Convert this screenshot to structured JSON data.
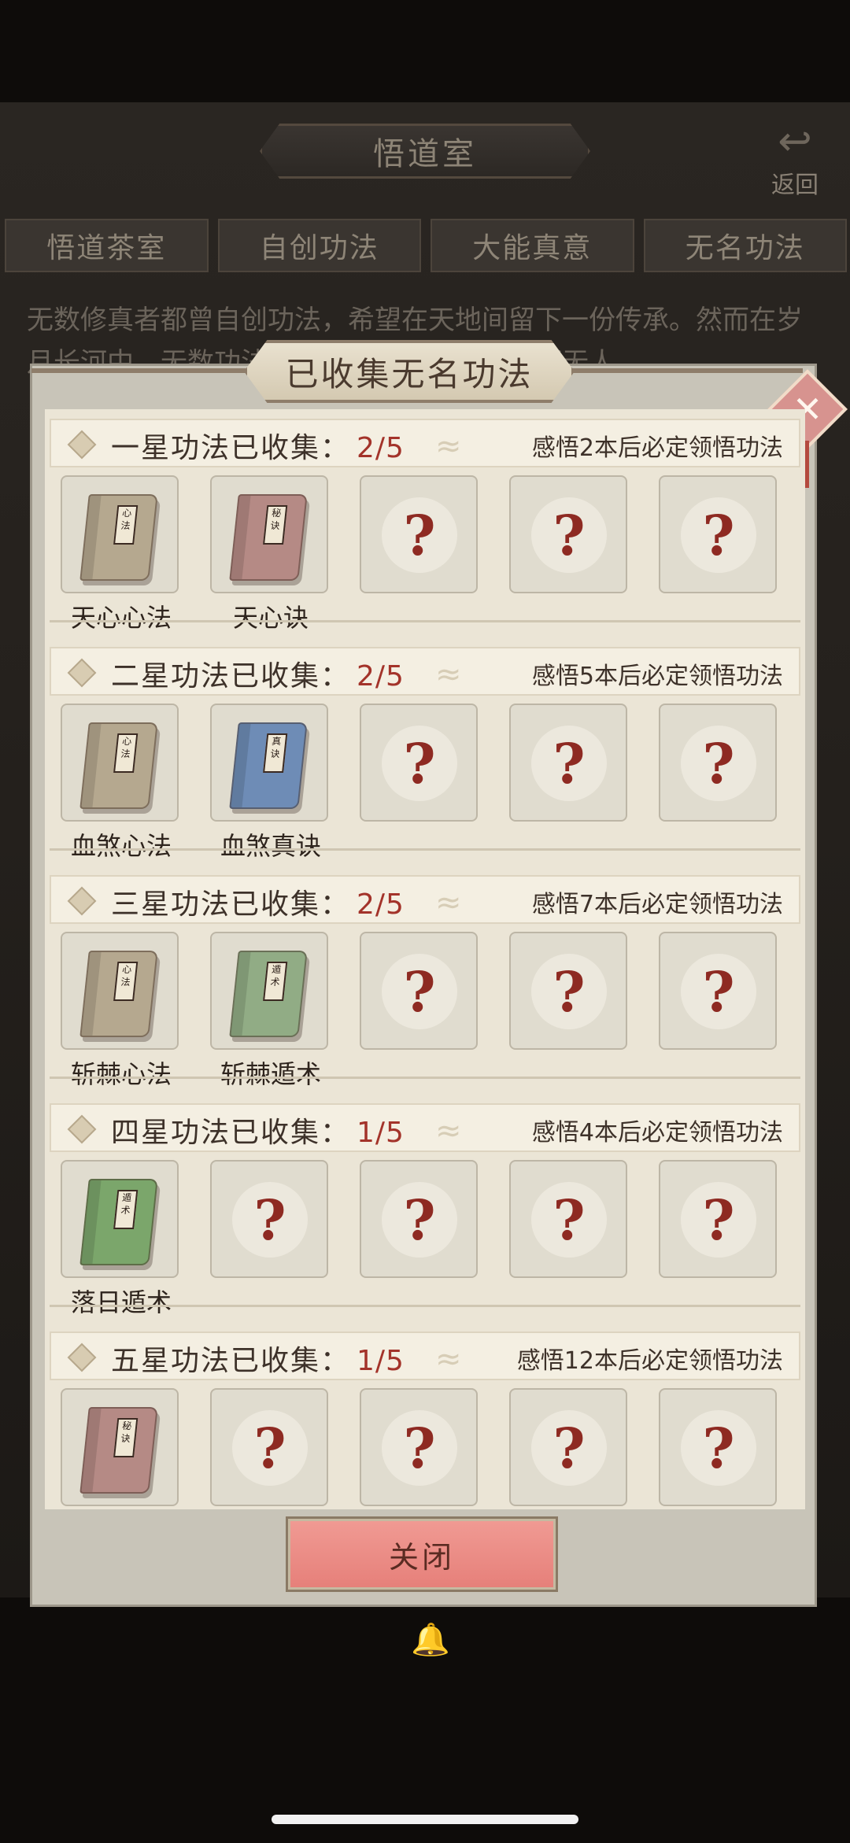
{
  "background": {
    "screen_title": "悟道室",
    "back_label": "返回",
    "tabs": [
      "悟道茶室",
      "自创功法",
      "大能真意",
      "无名功法"
    ],
    "description": "无数修真者都曾自创功法，希望在天地间留下一份传承。然而在岁月长河中，无数功法湮没而去，逐渐连名字都无人"
  },
  "dialog": {
    "title": "已收集无名功法",
    "close_icon": "close-x-icon",
    "close_button_label": "关闭"
  },
  "sections": [
    {
      "title": "一星功法已收集：",
      "count": "2/5",
      "hint": "感悟2本后必定领悟功法",
      "items": [
        {
          "name": "天心心法",
          "book_color": "#b5a88f",
          "tag": "心法"
        },
        {
          "name": "天心诀",
          "book_color": "#b58a85",
          "tag": "秘诀"
        },
        {
          "name": "",
          "unknown": "?"
        },
        {
          "name": "",
          "unknown": "?"
        },
        {
          "name": "",
          "unknown": "?"
        }
      ]
    },
    {
      "title": "二星功法已收集：",
      "count": "2/5",
      "hint": "感悟5本后必定领悟功法",
      "items": [
        {
          "name": "血煞心法",
          "book_color": "#b5a88f",
          "tag": "心法"
        },
        {
          "name": "血煞真诀",
          "book_color": "#6e8cb6",
          "tag": "真诀"
        },
        {
          "name": "",
          "unknown": "?"
        },
        {
          "name": "",
          "unknown": "?"
        },
        {
          "name": "",
          "unknown": "?"
        }
      ]
    },
    {
      "title": "三星功法已收集：",
      "count": "2/5",
      "hint": "感悟7本后必定领悟功法",
      "items": [
        {
          "name": "斩棘心法",
          "book_color": "#b5a88f",
          "tag": "心法"
        },
        {
          "name": "斩棘遁术",
          "book_color": "#91ac85",
          "tag": "遁术"
        },
        {
          "name": "",
          "unknown": "?"
        },
        {
          "name": "",
          "unknown": "?"
        },
        {
          "name": "",
          "unknown": "?"
        }
      ]
    },
    {
      "title": "四星功法已收集：",
      "count": "1/5",
      "hint": "感悟4本后必定领悟功法",
      "items": [
        {
          "name": "落日遁术",
          "book_color": "#7ba66b",
          "tag": "遁术"
        },
        {
          "name": "",
          "unknown": "?"
        },
        {
          "name": "",
          "unknown": "?"
        },
        {
          "name": "",
          "unknown": "?"
        },
        {
          "name": "",
          "unknown": "?"
        }
      ]
    },
    {
      "title": "五星功法已收集：",
      "count": "1/5",
      "hint": "感悟12本后必定领悟功法",
      "items": [
        {
          "name": "",
          "book_color": "#b58a85",
          "tag": "秘诀"
        },
        {
          "name": "",
          "unknown": "?"
        },
        {
          "name": "",
          "unknown": "?"
        },
        {
          "name": "",
          "unknown": "?"
        },
        {
          "name": "",
          "unknown": "?"
        }
      ]
    }
  ]
}
